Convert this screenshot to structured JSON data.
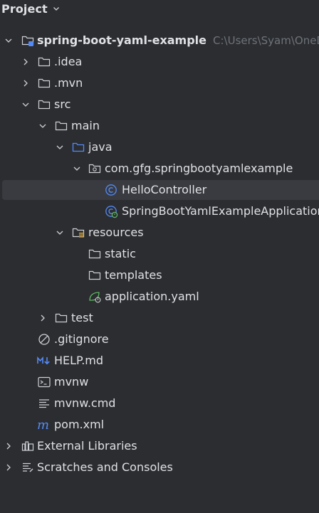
{
  "panel": {
    "title": "Project"
  },
  "tree": {
    "root": {
      "label": "spring-boot-yaml-example",
      "path": "C:\\Users\\Syam\\OneD"
    },
    "idea": ".idea",
    "mvn": ".mvn",
    "src": "src",
    "main": "main",
    "java": "java",
    "package": "com.gfg.springbootyamlexample",
    "hello_controller": "HelloController",
    "application_class": "SpringBootYamlExampleApplication",
    "resources": "resources",
    "static": "static",
    "templates": "templates",
    "application_yaml": "application.yaml",
    "test": "test",
    "gitignore": ".gitignore",
    "help_md": "HELP.md",
    "mvnw": "mvnw",
    "mvnw_cmd": "mvnw.cmd",
    "pom_xml": "pom.xml",
    "external_libraries": "External Libraries",
    "scratches": "Scratches and Consoles"
  },
  "icons": {
    "folder": "folder-icon",
    "source-folder": "source-folder-icon",
    "package": "package-icon",
    "class": "class-icon",
    "spring-app-class": "spring-boot-class-icon",
    "resources-folder": "resources-folder-icon",
    "yaml-file": "spring-yaml-icon",
    "ignore-file": "gitignore-icon",
    "markdown-file": "markdown-icon",
    "shell-file": "shell-script-icon",
    "text-file": "text-file-icon",
    "maven-file": "maven-icon",
    "libraries": "libraries-icon",
    "scratches": "scratches-icon"
  },
  "colors": {
    "background": "#2b2d30",
    "selection": "#393b40",
    "text": "#dfe1e5",
    "path_text": "#6f737a",
    "icon_gray": "#ced0d6",
    "accent_blue": "#548af7",
    "spring_green": "#5fb865"
  }
}
